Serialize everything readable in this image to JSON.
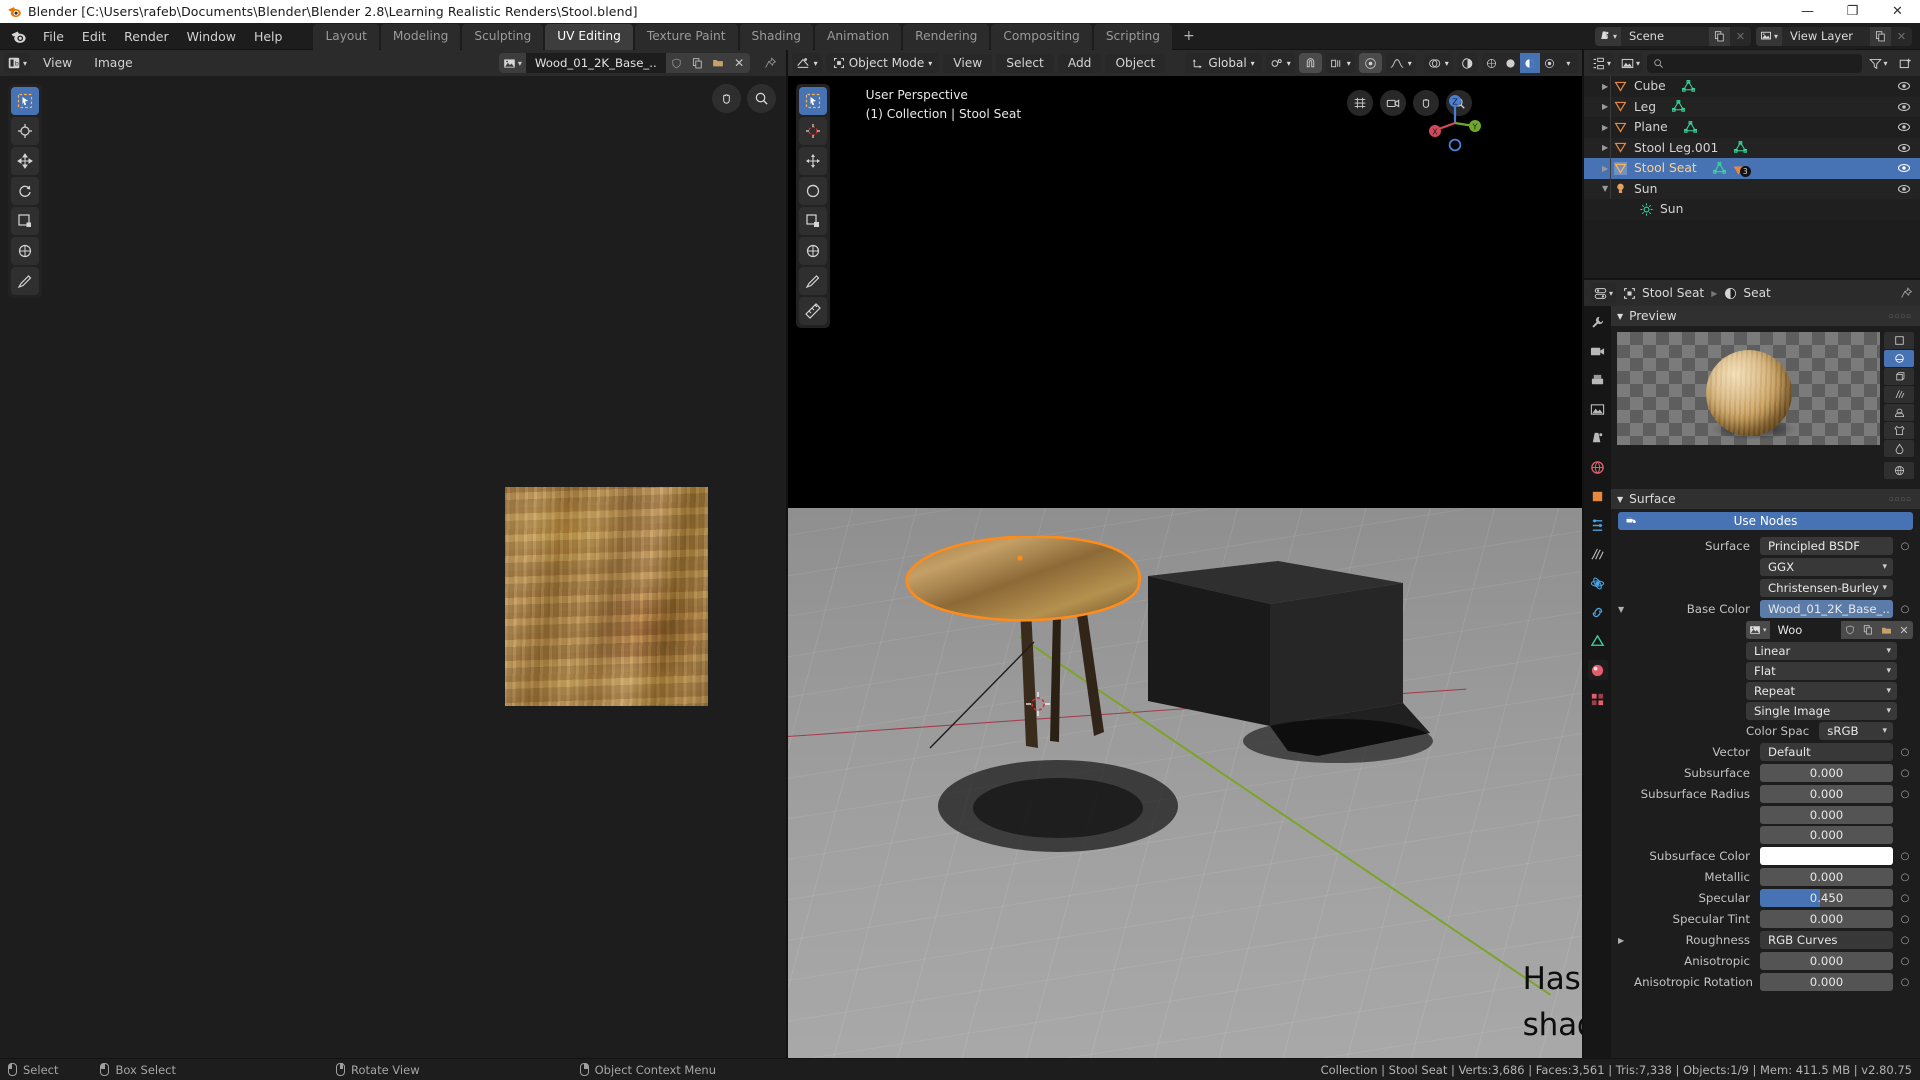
{
  "window": {
    "title": "Blender [C:\\Users\\rafeb\\Documents\\Blender\\Blender 2.8\\Learning Realistic Renders\\Stool.blend]",
    "minimize": "—",
    "maximize": "❐",
    "close": "✕"
  },
  "topbar": {
    "menus": [
      "File",
      "Edit",
      "Render",
      "Window",
      "Help"
    ],
    "workspaces": [
      {
        "label": "Layout",
        "active": false
      },
      {
        "label": "Modeling",
        "active": false
      },
      {
        "label": "Sculpting",
        "active": false
      },
      {
        "label": "UV Editing",
        "active": true
      },
      {
        "label": "Texture Paint",
        "active": false
      },
      {
        "label": "Shading",
        "active": false
      },
      {
        "label": "Animation",
        "active": false
      },
      {
        "label": "Rendering",
        "active": false
      },
      {
        "label": "Compositing",
        "active": false
      },
      {
        "label": "Scripting",
        "active": false
      }
    ],
    "add_workspace": "+",
    "scene": {
      "label": "Scene",
      "new_btn": "new-scene",
      "delete_btn": "delete-scene"
    },
    "view_layer": {
      "label": "View Layer",
      "new_btn": "new-view-layer",
      "delete_btn": "delete-view-layer"
    }
  },
  "uv_editor": {
    "editor_type": "uv-editor",
    "menus": [
      "View",
      "Image"
    ],
    "image_name": "Wood_01_2K_Base_..",
    "buttons": [
      "fake-user-shield",
      "new-image",
      "open-image",
      "unlink-image",
      "pin"
    ],
    "tools": [
      {
        "name": "tweak-tool",
        "active": true
      },
      {
        "name": "cursor-tool",
        "active": false
      },
      {
        "name": "move-tool",
        "active": false
      },
      {
        "name": "rotate-tool",
        "active": false
      },
      {
        "name": "scale-tool",
        "active": false
      },
      {
        "name": "transform-tool",
        "active": false
      },
      {
        "name": "annotate-tool",
        "active": false
      }
    ],
    "corner_buttons": [
      "grab-view",
      "zoom-view"
    ]
  },
  "viewport": {
    "mode": "Object Mode",
    "menus": [
      "View",
      "Select",
      "Add",
      "Object"
    ],
    "transform_orientation": "Global",
    "overlay_line_1": "User Perspective",
    "overlay_line_2": "(1) Collection | Stool Seat",
    "annotation": "Hasn't darkened on this side even though shadow is being cast, cube is for reference",
    "gizmo_axes": [
      "X",
      "Y",
      "Z"
    ],
    "tools": [
      {
        "name": "tweak-tool",
        "active": true
      },
      {
        "name": "cursor-tool",
        "active": false
      },
      {
        "name": "move-tool",
        "active": false
      },
      {
        "name": "rotate-tool",
        "active": false
      },
      {
        "name": "scale-tool",
        "active": false
      },
      {
        "name": "transform-tool",
        "active": false
      },
      {
        "name": "annotate-tool",
        "active": false
      },
      {
        "name": "measure-tool",
        "active": false
      }
    ],
    "header_icons": [
      "editor-type",
      "snap-magnet",
      "snap-target",
      "proportional-edit",
      "falloff",
      "shading-modes"
    ],
    "corner_icons": [
      "toggle-grid",
      "camera-view",
      "grab-view",
      "zoom-view"
    ]
  },
  "outliner": {
    "display_mode": "View Layer",
    "search_placeholder": "",
    "filter": "filter-icon",
    "new_collection": "new-collection-icon",
    "items": [
      {
        "name": "Cube",
        "type": "mesh",
        "selected": false,
        "indent": 1,
        "data_icons": [
          "mesh-data"
        ]
      },
      {
        "name": "Leg",
        "type": "mesh",
        "selected": false,
        "indent": 1,
        "data_icons": [
          "mesh-data"
        ]
      },
      {
        "name": "Plane",
        "type": "mesh",
        "selected": false,
        "indent": 1,
        "data_icons": [
          "mesh-data"
        ]
      },
      {
        "name": "Stool Leg.001",
        "type": "mesh",
        "selected": false,
        "indent": 1,
        "data_icons": [
          "mesh-data"
        ]
      },
      {
        "name": "Stool Seat",
        "type": "mesh",
        "selected": true,
        "indent": 1,
        "data_icons": [
          "mesh-data",
          "modifier"
        ],
        "badge": "3"
      },
      {
        "name": "Sun",
        "type": "light",
        "selected": false,
        "indent": 1,
        "data_icons": []
      },
      {
        "name": "Sun",
        "type": "light-data",
        "selected": false,
        "indent": 2,
        "data_icons": []
      }
    ]
  },
  "properties": {
    "breadcrumb": [
      {
        "label": "Stool Seat",
        "icon": "object-icon"
      },
      {
        "label": "Seat",
        "icon": "material-icon"
      }
    ],
    "pin": "pin-icon",
    "tabs": [
      {
        "name": "tool-tab",
        "active": false
      },
      {
        "name": "render-tab",
        "active": false
      },
      {
        "name": "output-tab",
        "active": false
      },
      {
        "name": "view-layer-tab",
        "active": false
      },
      {
        "name": "scene-tab",
        "active": false
      },
      {
        "name": "world-tab",
        "active": false
      },
      {
        "name": "object-tab",
        "active": false
      },
      {
        "name": "modifier-tab",
        "active": false
      },
      {
        "name": "particles-tab",
        "active": false
      },
      {
        "name": "physics-tab",
        "active": false
      },
      {
        "name": "constraints-tab",
        "active": false
      },
      {
        "name": "object-data-tab",
        "active": false
      },
      {
        "name": "material-tab",
        "active": true
      },
      {
        "name": "texture-tab",
        "active": false
      }
    ],
    "preview_panel": {
      "title": "Preview",
      "shapes": [
        {
          "name": "preview-flat",
          "selected": false
        },
        {
          "name": "preview-sphere",
          "selected": true
        },
        {
          "name": "preview-cube",
          "selected": false
        },
        {
          "name": "preview-hair",
          "selected": false
        },
        {
          "name": "preview-shaderball",
          "selected": false
        },
        {
          "name": "preview-cloth",
          "selected": false
        },
        {
          "name": "preview-fluid",
          "selected": false
        },
        {
          "name": "preview-world",
          "selected": false
        }
      ]
    },
    "surface_panel": {
      "title": "Surface",
      "use_nodes_label": "Use Nodes",
      "rows": [
        {
          "label": "Surface",
          "value": "Principled BSDF",
          "kind": "link",
          "expand": false,
          "dot": true
        },
        {
          "label": "",
          "value": "GGX",
          "kind": "dropdown",
          "expand": false,
          "dot": false
        },
        {
          "label": "",
          "value": "Christensen-Burley",
          "kind": "dropdown",
          "expand": false,
          "dot": false
        },
        {
          "label": "Base Color",
          "value": "Wood_01_2K_Base_..",
          "kind": "link",
          "expand": true,
          "dot": true
        }
      ],
      "texture_row": {
        "name": "Woo",
        "buttons": [
          "fake-user-shield",
          "new-image",
          "open-image",
          "unlink-image"
        ]
      },
      "texture_settings": [
        {
          "value": "Linear",
          "kind": "dropdown"
        },
        {
          "value": "Flat",
          "kind": "dropdown"
        },
        {
          "value": "Repeat",
          "kind": "dropdown"
        },
        {
          "value": "Single Image",
          "kind": "dropdown"
        }
      ],
      "color_space": {
        "label": "Color Spac",
        "value": "sRGB"
      },
      "params": [
        {
          "label": "Vector",
          "value": "Default",
          "kind": "link",
          "dot": true,
          "expand": false
        },
        {
          "label": "Subsurface",
          "value": "0.000",
          "kind": "value",
          "dot": true,
          "expand": false
        },
        {
          "label": "Subsurface Radius",
          "value": "0.000",
          "kind": "value",
          "dot": true,
          "expand": false
        },
        {
          "label": "",
          "value": "0.000",
          "kind": "value",
          "dot": false,
          "expand": false
        },
        {
          "label": "",
          "value": "0.000",
          "kind": "value",
          "dot": false,
          "expand": false
        },
        {
          "label": "Subsurface Color",
          "value": "",
          "kind": "color",
          "color": "#ffffff",
          "dot": true,
          "expand": false
        },
        {
          "label": "Metallic",
          "value": "0.000",
          "kind": "value",
          "dot": true,
          "expand": false
        },
        {
          "label": "Specular",
          "value": "0.450",
          "kind": "slider",
          "fill": 45,
          "dot": true,
          "expand": false
        },
        {
          "label": "Specular Tint",
          "value": "0.000",
          "kind": "value",
          "dot": true,
          "expand": false
        },
        {
          "label": "Roughness",
          "value": "RGB Curves",
          "kind": "link",
          "dot": true,
          "expand": true
        },
        {
          "label": "Anisotropic",
          "value": "0.000",
          "kind": "value",
          "dot": true,
          "expand": false
        },
        {
          "label": "Anisotropic Rotation",
          "value": "0.000",
          "kind": "value",
          "dot": true,
          "expand": false
        }
      ]
    }
  },
  "statusbar": {
    "hints": [
      {
        "mouse": "left",
        "label": "Select"
      },
      {
        "mouse": "left-drag",
        "label": "Box Select"
      },
      {
        "mouse": "middle",
        "label": "Rotate View"
      },
      {
        "mouse": "right",
        "label": "Object Context Menu"
      }
    ],
    "stats": "Collection | Stool Seat | Verts:3,686 | Faces:3,561 | Tris:7,338 | Objects:1/9 | Mem: 411.5 MB | v2.80.75"
  },
  "colors": {
    "accent_blue": "#4772b3",
    "selected_orange": "#ff8c1a",
    "mesh_green": "#3cd69a",
    "header_bg": "#2b2b2b",
    "panel_bg": "#1d1d1d"
  }
}
